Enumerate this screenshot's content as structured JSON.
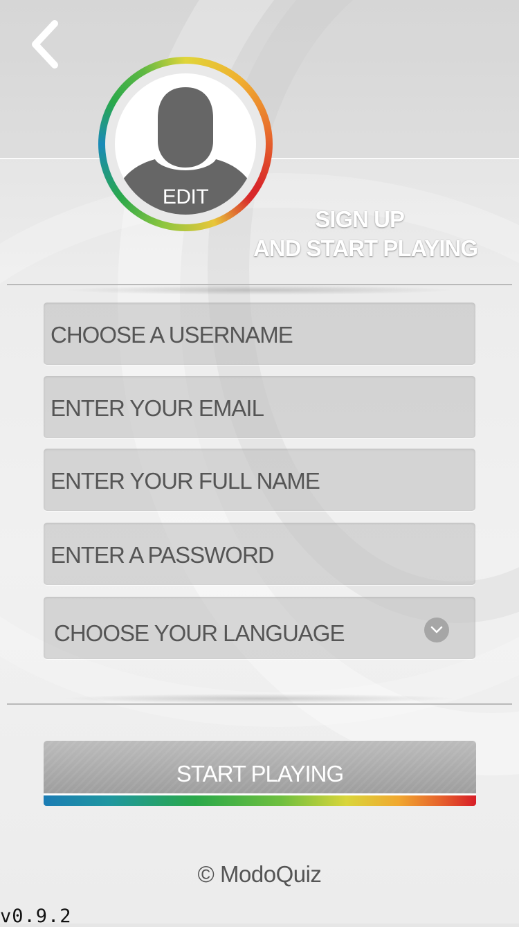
{
  "header": {
    "back_icon": "chevron-left-icon"
  },
  "avatar": {
    "edit_label": "EDIT",
    "icon": "user-silhouette-icon",
    "ring_colors": [
      "#1a8ab8",
      "#2aa84a",
      "#e0d53a",
      "#e8702c",
      "#d8282a"
    ]
  },
  "heading": {
    "line1": "SIGN UP",
    "line2": "AND START PLAYING"
  },
  "form": {
    "username_placeholder": "CHOOSE A USERNAME",
    "email_placeholder": "ENTER YOUR EMAIL",
    "fullname_placeholder": "ENTER YOUR FULL NAME",
    "password_placeholder": "ENTER A PASSWORD",
    "language_placeholder": "CHOOSE YOUR LANGUAGE",
    "language_icon": "chevron-down-icon"
  },
  "actions": {
    "start_label": "START PLAYING"
  },
  "footer": {
    "copyright": "© ModoQuiz",
    "version": "v0.9.2"
  },
  "colors": {
    "accent_gradient": [
      "#1b7cb4",
      "#2aa84a",
      "#d9d53a",
      "#f0a830",
      "#d71e28"
    ],
    "button_gray": "#a8a8a8",
    "text_gray": "#555555"
  }
}
